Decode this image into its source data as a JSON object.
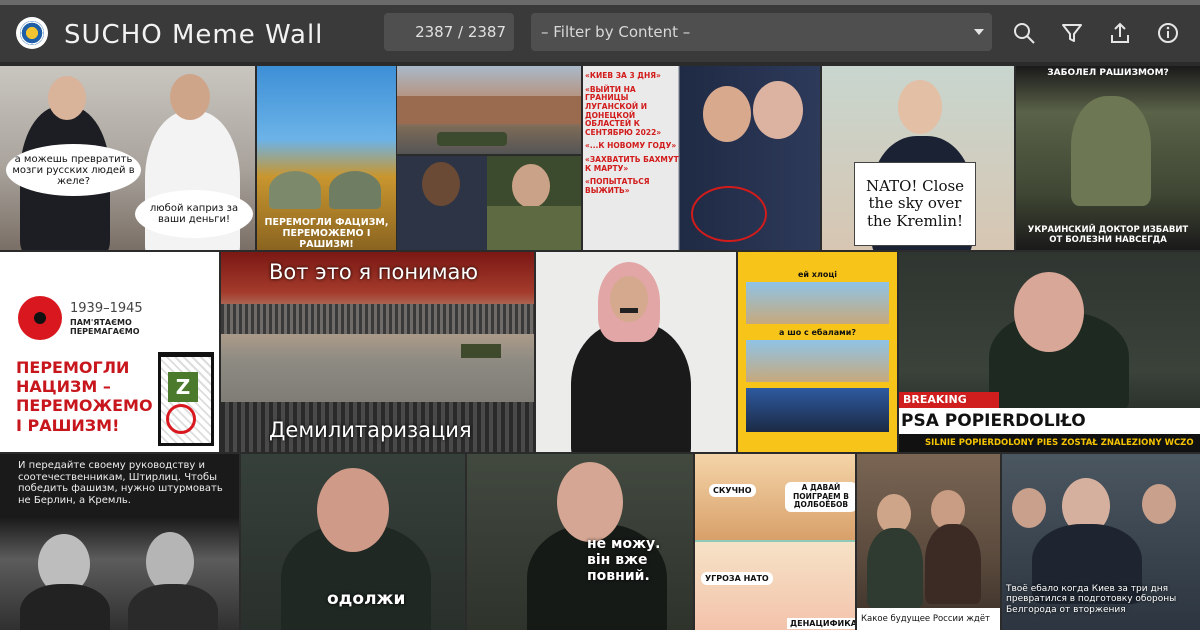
{
  "header": {
    "title": "SUCHO Meme Wall",
    "counter": "2387 / 2387",
    "filter_placeholder": "– Filter by Content –",
    "icons": [
      "search-icon",
      "filter-icon",
      "upload-icon",
      "info-icon"
    ]
  },
  "tiles": {
    "t1": {
      "bubble1": "а можешь превратить мозги русских людей в желе?",
      "bubble2": "любой каприз за ваши деньги!"
    },
    "t2": {
      "caption": "ПЕРЕМОГЛИ ФАЦИЗМ, ПЕРЕМОЖЕМО І РАШИЗМ!"
    },
    "t5": {
      "lines": [
        "«КИЕВ ЗА 3 ДНЯ»",
        "«ВЫЙТИ НА ГРАНИЦЫ ЛУГАНСКОЙ И ДОНЕЦКОЙ ОБЛАСТЕЙ К СЕНТЯБРЮ 2022»",
        "«...К НОВОМУ ГОДУ»",
        "«ЗАХВАТИТЬ БАХМУТ К МАРТУ»",
        "«ПОПЫТАТЬСЯ ВЫЖИТЬ»"
      ]
    },
    "t6": {
      "sign": "NATO! Close the sky over the Kremlin!"
    },
    "t7": {
      "top": "ЗАБОЛЕЛ РАШИЗМОМ?",
      "bottom": "УКРАИНСКИЙ ДОКТОР ИЗБАВИТ ОТ БОЛЕЗНИ НАВСЕГДА"
    },
    "t8": {
      "years": "1939–1945",
      "remember": "ПАМ'ЯТАЄМО ПЕРЕМАГАЄМО",
      "slogan": "ПЕРЕМОГЛИ НАЦИЗМ – ПЕРЕМОЖЕМО І РАШИЗМ!"
    },
    "t9": {
      "top": "Вот это я понимаю",
      "bottom": "Демилитаризация"
    },
    "t11": {
      "q1": "ей хлоці",
      "q2": "а шо с ебалами?"
    },
    "t12": {
      "banner": "BREAKING NEWS",
      "headline": "PSA POPIERDOLIŁO",
      "ticker": "SILNIE POPIERDOLONY PIES ZOSTAŁ ZNALEZIONY WCZO"
    },
    "t13": {
      "quote": "И передайте своему руководству и соотечественникам, Штирлиц. Чтобы победить фашизм, нужно штурмовать не Берлин, а Кремль."
    },
    "t14": {
      "caption": "одолжи"
    },
    "t15": {
      "caption": "не можу. він вже повний."
    },
    "t16": {
      "b1": "СКУЧНО",
      "b2": "А ДАВАЙ ПОИГРАЕМ В ДОЛБОЁБОВ",
      "b3": "УГРОЗА НАТО",
      "b4": "ДЕНАЦИФИКА"
    },
    "t17": {
      "caption": "Какое будущее России ждёт"
    },
    "t18": {
      "caption": "Твоё ебало когда Киев за три дня превратился в подготовку обороны Белгорода от вторжения"
    }
  }
}
